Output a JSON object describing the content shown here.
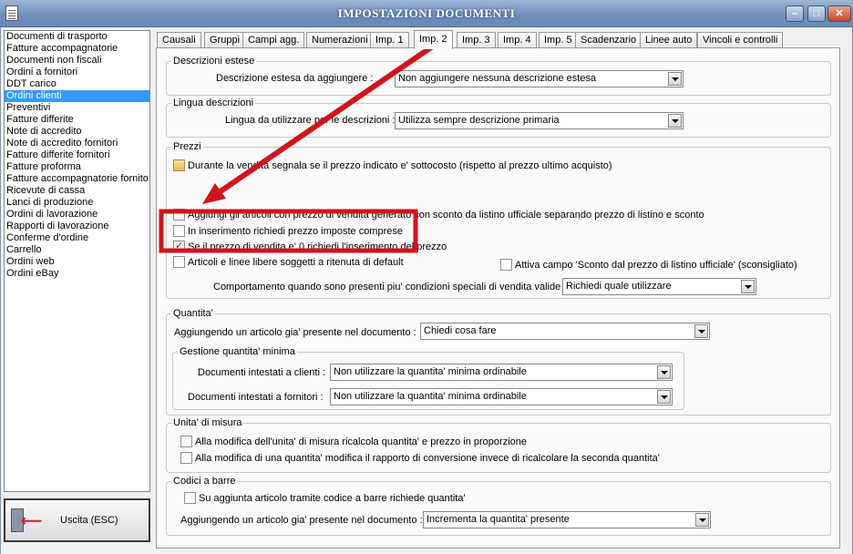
{
  "window": {
    "title": "IMPOSTAZIONI DOCUMENTI"
  },
  "sidebar": {
    "items": [
      {
        "label": "Documenti di trasporto"
      },
      {
        "label": "Fatture accompagnatorie"
      },
      {
        "label": "Documenti non fiscali"
      },
      {
        "label": "Ordini a fornitori"
      },
      {
        "label": "DDT carico"
      },
      {
        "label": "Ordini clienti",
        "selected": true
      },
      {
        "label": "Preventivi"
      },
      {
        "label": "Fatture differite"
      },
      {
        "label": "Note di accredito"
      },
      {
        "label": "Note di accredito fornitori"
      },
      {
        "label": "Fatture differite fornitori"
      },
      {
        "label": "Fatture proforma"
      },
      {
        "label": "Fatture accompagnatorie fornito"
      },
      {
        "label": "Ricevute di cassa"
      },
      {
        "label": "Lanci di produzione"
      },
      {
        "label": "Ordini di lavorazione"
      },
      {
        "label": "Rapporti di lavorazione"
      },
      {
        "label": "Conferme d'ordine"
      },
      {
        "label": "Carrello"
      },
      {
        "label": "Ordini web"
      },
      {
        "label": "Ordini eBay"
      }
    ],
    "exit_label": "Uscita (ESC)"
  },
  "tabs": [
    "Causali",
    "Gruppi",
    "Campi agg.",
    "Numerazioni",
    "Imp. 1",
    "Imp. 2",
    "Imp. 3",
    "Imp. 4",
    "Imp. 5",
    "Scadenzario",
    "Linee auto",
    "Vincoli e controlli"
  ],
  "active_tab": "Imp. 2",
  "descrizioni": {
    "legend": "Descrizioni estese",
    "label": "Descrizione estesa da aggiungere :",
    "value": "Non aggiungere nessuna descrizione estesa"
  },
  "lingua": {
    "legend": "Lingua descrizioni",
    "label": "Lingua da utilizzare per le descrizioni :",
    "value": "Utilizza sempre descrizione primaria"
  },
  "prezzi": {
    "legend": "Prezzi",
    "sottocosto": "Durante la vendita segnala se il prezzo indicato e' sottocosto (rispetto al prezzo ultimo acquisto)",
    "aggiungi": "Aggiungi gli articoli con prezzo di vendita generato con sconto da listino ufficiale separando prezzo di listino e sconto",
    "imposte": "In inserimento richiedi prezzo imposte comprese",
    "zero": "Se il prezzo di vendita e' 0 richiedi l'inserimento del prezzo",
    "ritenuta": "Articoli e linee libere soggetti a ritenuta di default",
    "sconto_listino": "Attiva campo 'Sconto dal prezzo di listino ufficiale' (sconsigliato)",
    "comportamento_label": "Comportamento quando sono presenti piu' condizioni speciali di vendita valide :",
    "comportamento_value": "Richiedi quale utilizzare"
  },
  "quantita": {
    "legend": "Quantita'",
    "aggiungendo_label": "Aggiungendo un articolo gia' presente nel documento :",
    "aggiungendo_value": "Chiedi cosa fare",
    "minima_legend": "Gestione quantita' minima",
    "clienti_label": "Documenti intestati a clienti :",
    "clienti_value": "Non utilizzare la quantita' minima ordinabile",
    "fornitori_label": "Documenti intestati a fornitori :",
    "fornitori_value": "Non utilizzare la quantita' minima ordinabile"
  },
  "unita": {
    "legend": "Unita' di misura",
    "opt1": "Alla modifica dell'unita' di misura ricalcola quantita' e prezzo in proporzione",
    "opt2": "Alla modifica di una quantita' modifica il rapporto di conversione invece di ricalcolare la seconda quantita'"
  },
  "barre": {
    "legend": "Codici a barre",
    "opt1": "Su aggiunta articolo tramite codice a barre richiede quantita'",
    "aggiungendo_label": "Aggiungendo un articolo gia' presente nel documento :",
    "aggiungendo_value": "Incrementa la quantita' presente"
  },
  "colors": {
    "highlight_box": "#d0141c",
    "arrow": "#d0141c",
    "selection": "#3399ff"
  }
}
